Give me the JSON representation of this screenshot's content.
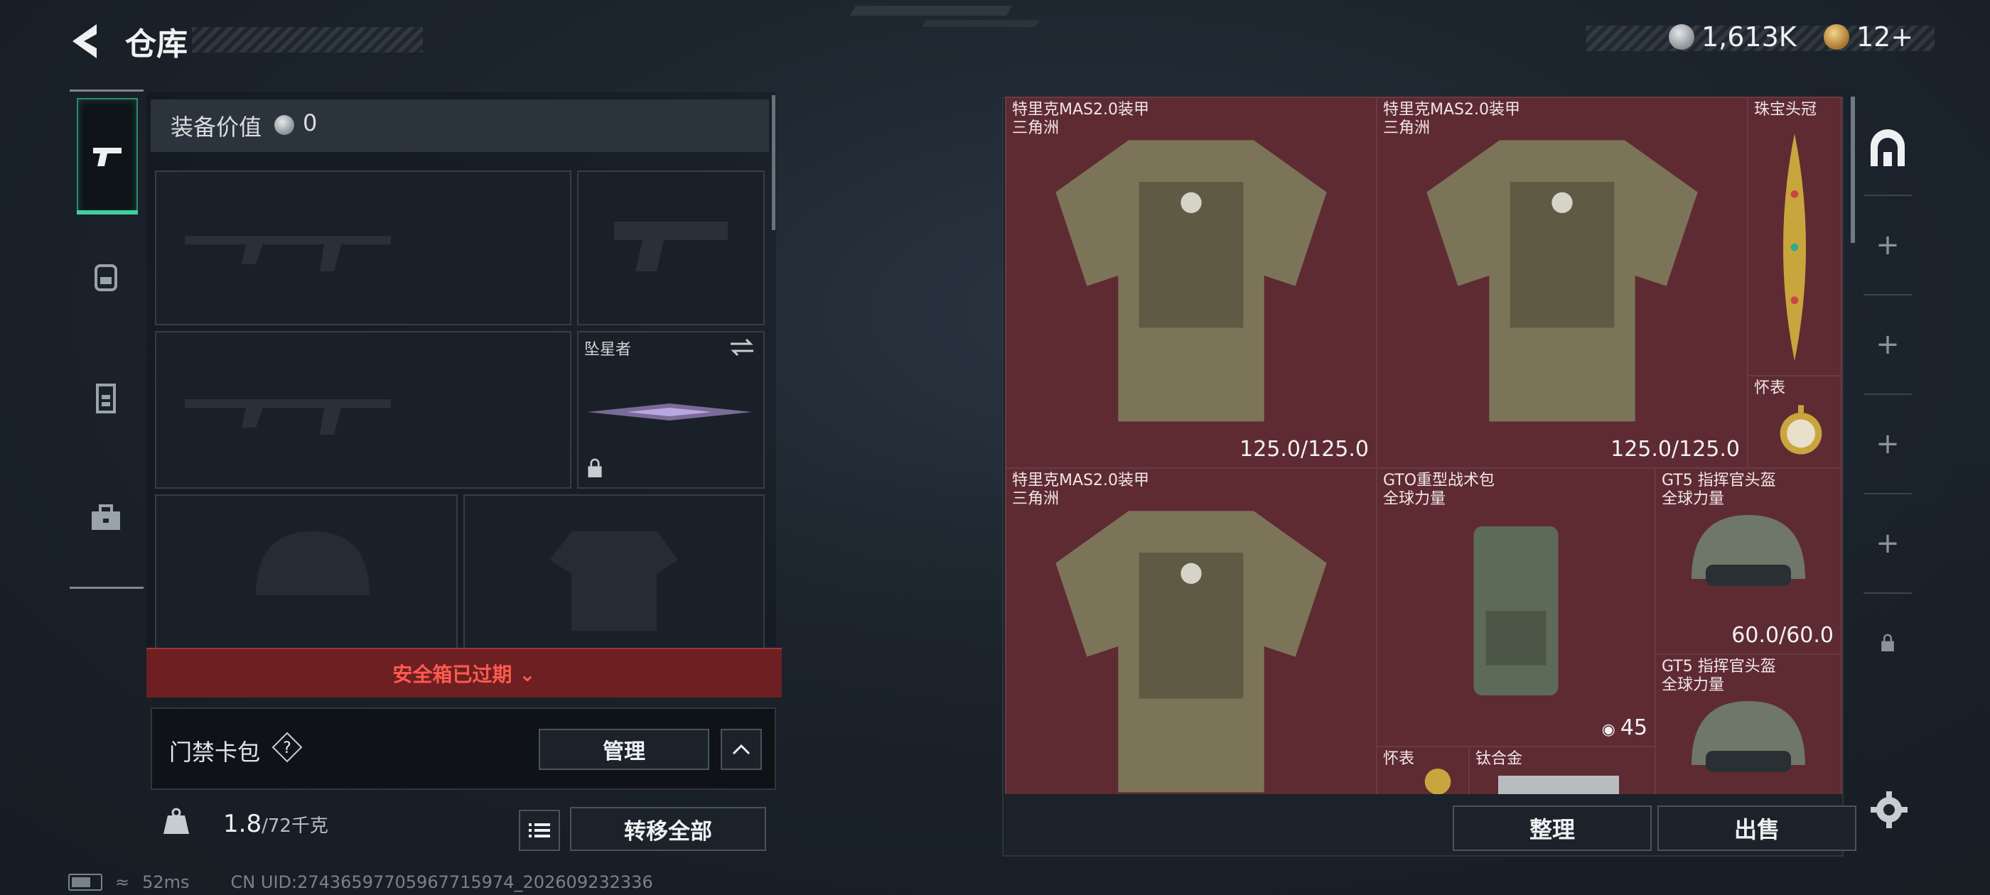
{
  "header": {
    "title": "仓库",
    "currency_silver": "1,613K",
    "currency_gold": "12+"
  },
  "loadout": {
    "equip_value_label": "装备价值",
    "equip_value": "0",
    "melee_name": "坠星者",
    "safebox_status": "安全箱已过期",
    "keycard_label": "门禁卡包",
    "manage_label": "管理",
    "weight_current": "1.8",
    "weight_max": "/72千克",
    "transfer_all_label": "转移全部"
  },
  "status": {
    "ping": "52ms",
    "uid": "CN UID:27436597705967715974_202609232336"
  },
  "storage": {
    "items": [
      {
        "name": "特里克MAS2.0装甲\n三角洲",
        "durability": "125.0/125.0"
      },
      {
        "name": "特里克MAS2.0装甲\n三角洲",
        "durability": "125.0/125.0"
      },
      {
        "name": "珠宝头冠",
        "durability": ""
      },
      {
        "name": "怀表",
        "durability": ""
      },
      {
        "name": "特里克MAS2.0装甲\n三角洲",
        "durability": ""
      },
      {
        "name": "GTO重型战术包\n全球力量",
        "durability": "45"
      },
      {
        "name": "GT5 指挥官头盔\n全球力量",
        "durability": "60.0/60.0"
      },
      {
        "name": "GT5 指挥官头盔\n全球力量",
        "durability": ""
      },
      {
        "name": "怀表",
        "durability": ""
      },
      {
        "name": "钛合金",
        "durability": ""
      }
    ],
    "sort_label": "整理",
    "sell_label": "出售"
  },
  "colors": {
    "accent_green": "#3fd0a0",
    "warning_red": "#ff5a4e",
    "grid_bg": "#4b1f27"
  },
  "icons": {
    "left_rail": [
      "pistol-icon",
      "backpack-icon",
      "vest-icon",
      "briefcase-icon"
    ],
    "right_rail": [
      "stash-icon",
      "add-icon",
      "add-icon",
      "add-icon",
      "add-icon",
      "lock-icon"
    ]
  }
}
